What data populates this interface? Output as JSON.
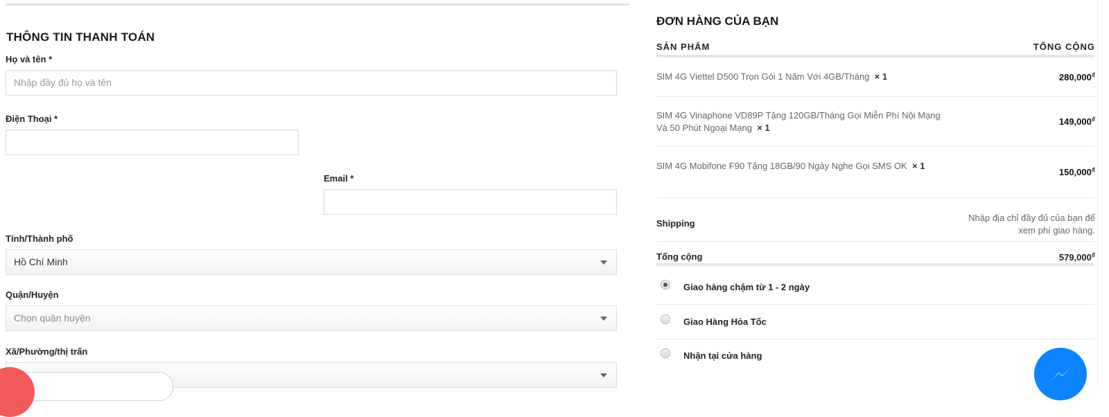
{
  "billing": {
    "title": "THÔNG TIN THANH TOÁN",
    "name_label": "Họ và tên *",
    "name_placeholder": "Nhập đầy đủ họ và tên",
    "phone_label": "Điện Thoại *",
    "email_label": "Email *",
    "city_label": "Tỉnh/Thành phố",
    "city_value": "Hồ Chí Minh",
    "district_label": "Quận/Huyện",
    "district_value": "Chọn quận huyện",
    "ward_label": "Xã/Phường/thị trấn"
  },
  "order": {
    "title": "ĐƠN HÀNG CỦA BẠN",
    "col_product": "SẢN PHẨM",
    "col_total": "TỔNG CỘNG",
    "items": [
      {
        "name": "SIM 4G Viettel D500 Trọn Gói 1 Năm Với 4GB/Tháng",
        "qty": "× 1",
        "price": "280,000",
        "currency": "₫"
      },
      {
        "name": "SIM 4G Vinaphone VD89P Tặng 120GB/Tháng Gọi Miễn Phí Nội Mạng Và 50 Phút Ngoại Mạng",
        "qty": "× 1",
        "price": "149,000",
        "currency": "₫"
      },
      {
        "name": "SIM 4G Mobifone F90 Tặng 18GB/90 Ngày Nghe Gọi SMS OK",
        "qty": "× 1",
        "price": "150,000",
        "currency": "₫"
      }
    ],
    "shipping_label": "Shipping",
    "shipping_note": "Nhập địa chỉ đầy đủ của bạn để xem phí giao hàng.",
    "total_label": "Tổng cộng",
    "total_value": "579,000",
    "total_currency": "₫",
    "shipping_options": [
      {
        "label": "Giao hàng chậm từ 1 - 2 ngày",
        "selected": true
      },
      {
        "label": "Giao Hàng Hỏa Tốc",
        "selected": false
      },
      {
        "label": "Nhận tại cửa hàng",
        "selected": false
      }
    ]
  },
  "icons": {
    "chat": "messenger-icon"
  },
  "colors": {
    "messenger": "#0a84ff",
    "badge": "#f05a5a"
  }
}
